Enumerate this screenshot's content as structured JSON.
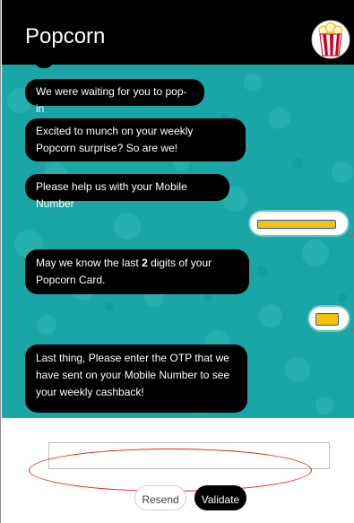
{
  "header": {
    "title": "Popcorn",
    "logo_icon": "popcorn-bucket-icon"
  },
  "messages": [
    {
      "from": "bot",
      "text": "We were waiting for you to pop-in"
    },
    {
      "from": "bot",
      "text": "Excited to munch on your weekly Popcorn surprise? So are we!"
    },
    {
      "from": "bot",
      "text": "Please help us with your Mobile Number"
    },
    {
      "from": "user",
      "text": ""
    },
    {
      "from": "bot",
      "text_before": "May we know the last ",
      "text_bold": "2",
      "text_after": " digits of your Popcorn Card."
    },
    {
      "from": "user",
      "text": ""
    },
    {
      "from": "bot",
      "text": "Last thing, Please enter the OTP that we have sent on your Mobile Number to see your weekly cashback!"
    }
  ],
  "otp_input": {
    "value": "",
    "placeholder": ""
  },
  "buttons": {
    "resend": "Resend",
    "validate": "Validate"
  },
  "colors": {
    "chat_background": "#1aa5a6",
    "bubble_bot": "#000000",
    "header": "#000000",
    "user_fill": "#f5c10a",
    "annotation": "#e02020"
  }
}
